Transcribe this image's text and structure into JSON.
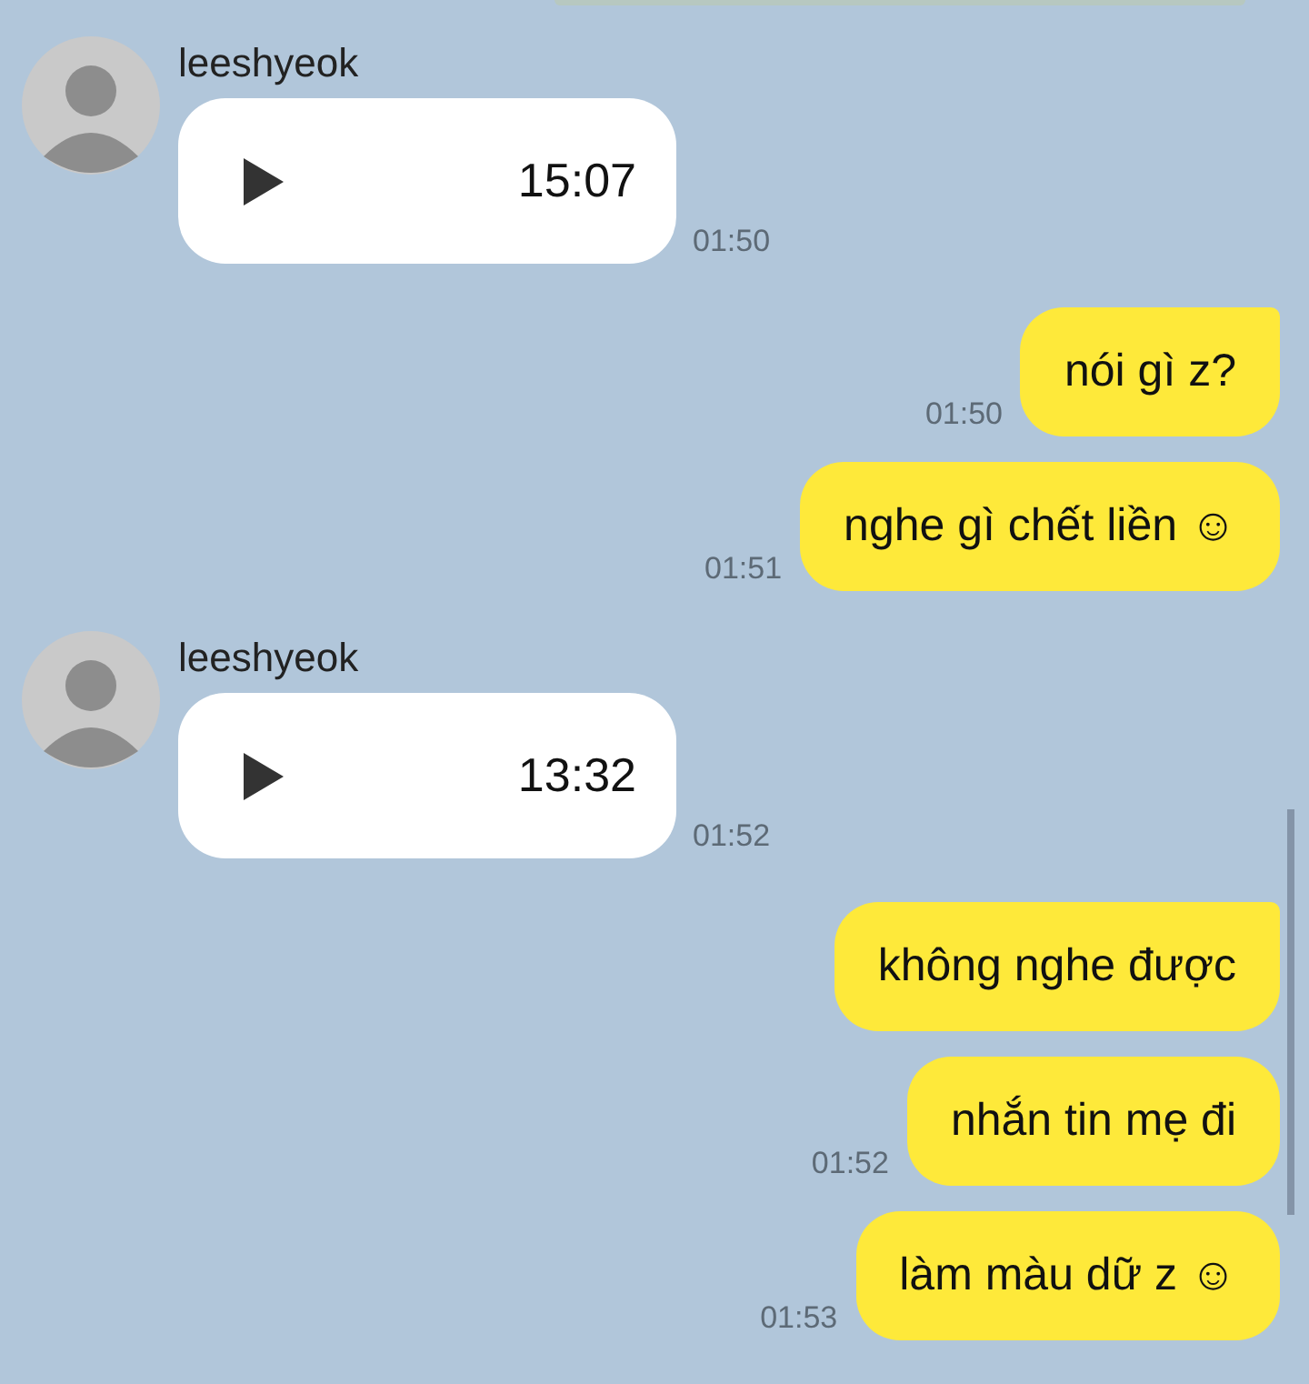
{
  "messages": [
    {
      "kind": "incoming_voice",
      "sender": "leeshyeok",
      "duration": "15:07",
      "time": "01:50"
    },
    {
      "kind": "outgoing",
      "text": "nói gì z?",
      "time": "01:50",
      "tail": true
    },
    {
      "kind": "outgoing",
      "text": "nghe gì chết liền ☺",
      "time": "01:51",
      "tail": false
    },
    {
      "kind": "incoming_voice",
      "sender": "leeshyeok",
      "duration": "13:32",
      "time": "01:52"
    },
    {
      "kind": "outgoing",
      "text": "không nghe được",
      "tail": true
    },
    {
      "kind": "outgoing",
      "text": "nhắn tin mẹ đi",
      "time": "01:52",
      "tail": false
    },
    {
      "kind": "outgoing",
      "text": "làm màu dữ z ☺",
      "time": "01:53",
      "tail": false
    }
  ]
}
